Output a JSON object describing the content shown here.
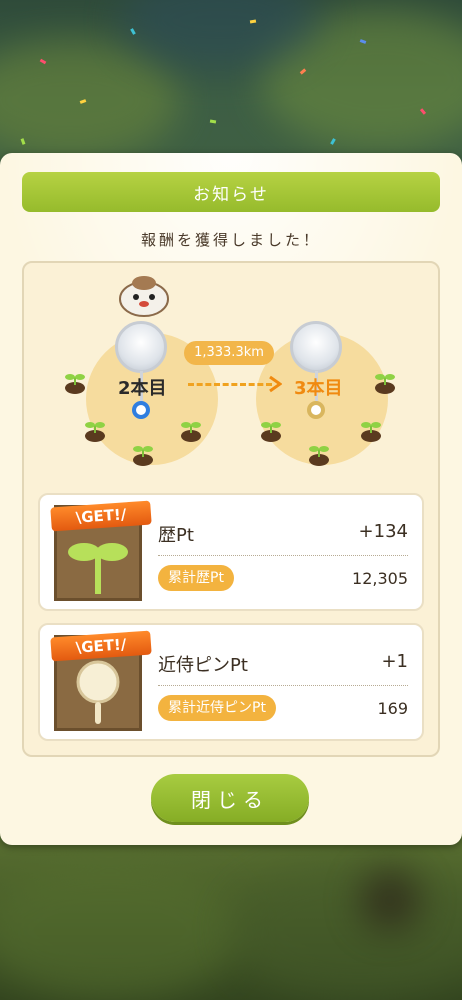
{
  "dialog": {
    "title": "お知らせ",
    "subtitle": "報酬を獲得しました！",
    "close_label": "閉じる"
  },
  "progress": {
    "from_label": "2本目",
    "to_label": "3本目",
    "distance": "1,333.3km"
  },
  "rewards": [
    {
      "badge": "\\GET!/",
      "name": "歴Pt",
      "gain": "+134",
      "total_label": "累計歴Pt",
      "total": "12,305",
      "icon": "sprout-icon"
    },
    {
      "badge": "\\GET!/",
      "name": "近侍ピンPt",
      "gain": "+1",
      "total_label": "累計近侍ピンPt",
      "total": "169",
      "icon": "pin-icon"
    }
  ],
  "colors": {
    "accent_green": "#9bbf2f",
    "accent_orange": "#f3b33f",
    "panel": "#fdf7e2"
  }
}
